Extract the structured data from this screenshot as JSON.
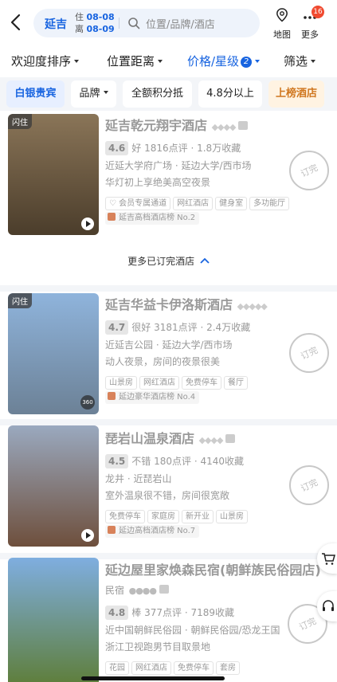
{
  "header": {
    "city": "延吉",
    "checkin_label": "住",
    "checkin_date": "08-08",
    "checkout_label": "离",
    "checkout_date": "08-09",
    "search_placeholder": "位置/品牌/酒店",
    "map_label": "地图",
    "more_label": "更多",
    "more_badge": "16"
  },
  "sort_bar": {
    "welcome_sort": "欢迎度排序",
    "distance": "位置距离",
    "price_star": "价格/星级",
    "price_star_count": "2",
    "filter": "筛选"
  },
  "chips": [
    "白银贵宾",
    "品牌",
    "全额积分抵",
    "4.8分以上",
    "上榜酒店"
  ],
  "more_booked": "更多已订完酒店",
  "stamp_text": "订完",
  "hotels": [
    {
      "photo_tag": "闪住",
      "name": "延吉乾元翔宇酒店",
      "score": "4.6",
      "rating_word": "好",
      "reviews": "1816点评",
      "favorites": "1.8万收藏",
      "location": "近延大学府广场 · 延边大学/西市场",
      "description": "华灯初上享绝美高空夜景",
      "tags": [
        "会员专属通道",
        "网红酒店",
        "健身室",
        "多功能厅"
      ],
      "rank": "延吉高档酒店榜 No.2",
      "colors": {
        "photo_top": "#8a7558",
        "photo_bottom": "#4b3d2b"
      }
    },
    {
      "photo_tag": "闪住",
      "name": "延吉华益卡伊洛斯酒店",
      "score": "4.7",
      "rating_word": "很好",
      "reviews": "3181点评",
      "favorites": "2.4万收藏",
      "location": "近延吉公园 · 延边大学/西市场",
      "description": "动人夜景，房间的夜景很美",
      "tags": [
        "山景房",
        "网红酒店",
        "免费停车",
        "餐厅"
      ],
      "rank": "延边豪华酒店榜 No.4",
      "badge_360": "360",
      "colors": {
        "photo_top": "#8fb4dc",
        "photo_bottom": "#6c8196"
      }
    },
    {
      "name": "琵岩山温泉酒店",
      "score": "4.5",
      "rating_word": "不错",
      "reviews": "180点评",
      "favorites": "4140收藏",
      "location": "龙井 · 近琵岩山",
      "description": "室外温泉很不错，房间很宽敞",
      "tags": [
        "免费停车",
        "家庭房",
        "新开业",
        "山景房"
      ],
      "rank": "延边高档酒店榜 No.7",
      "colors": {
        "photo_top": "#9aa9bf",
        "photo_bottom": "#6e4f3c"
      }
    },
    {
      "name": "延边屋里家焕森民宿(朝鲜族民俗园店)",
      "type": "民宿",
      "score": "4.8",
      "rating_word": "棒",
      "reviews": "377点评",
      "favorites": "7189收藏",
      "location": "近中国朝鲜民俗园 · 朝鲜民俗园/恐龙王国",
      "description": "浙江卫视跑男节目取景地",
      "tags": [
        "花园",
        "网红酒店",
        "免费停车",
        "套房"
      ],
      "colors": {
        "photo_top": "#7faee0",
        "photo_bottom": "#5f7f3e"
      }
    }
  ]
}
